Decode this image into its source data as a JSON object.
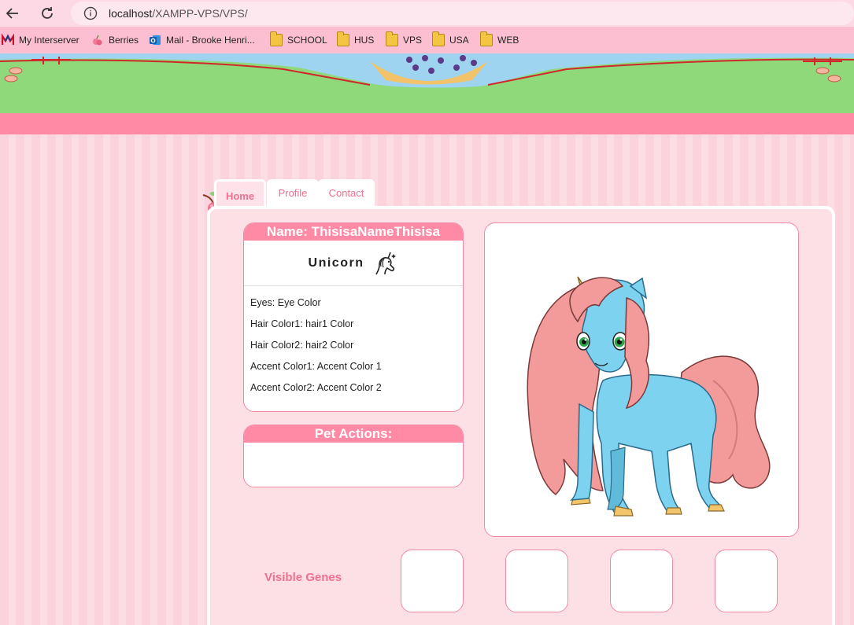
{
  "browser": {
    "url_host": "localhost",
    "url_path": "/XAMPP-VPS/VPS/",
    "bookmarks": [
      {
        "label": "My Interserver",
        "icon": "interserver-icon"
      },
      {
        "label": "Berries",
        "icon": "berries-icon"
      },
      {
        "label": "Mail - Brooke Henri...",
        "icon": "outlook-icon"
      },
      {
        "label": "SCHOOL",
        "icon": "folder-icon"
      },
      {
        "label": "HUS",
        "icon": "folder-icon"
      },
      {
        "label": "VPS",
        "icon": "folder-icon"
      },
      {
        "label": "USA",
        "icon": "folder-icon"
      },
      {
        "label": "WEB",
        "icon": "folder-icon"
      }
    ]
  },
  "tabs": [
    {
      "label": "Home",
      "active": true
    },
    {
      "label": "Profile",
      "active": false
    },
    {
      "label": "Contact",
      "active": false
    }
  ],
  "pet": {
    "name_header": "Name: ThisisaNameThisisa",
    "species": "Unicorn",
    "traits": [
      "Eyes: Eye Color",
      "Hair Color1: hair1 Color",
      "Hair Color2: hair2 Color",
      "Accent Color1: Accent Color 1",
      "Accent Color2: Accent Color 2"
    ],
    "actions_header": "Pet Actions:",
    "genes_label": "Visible Genes",
    "gene_slots": 4
  },
  "colors": {
    "accent_pink": "#ff8aa6",
    "text_pink": "#f0708f",
    "pony_body": "#7dd3ef",
    "pony_mane": "#f39a9a"
  }
}
